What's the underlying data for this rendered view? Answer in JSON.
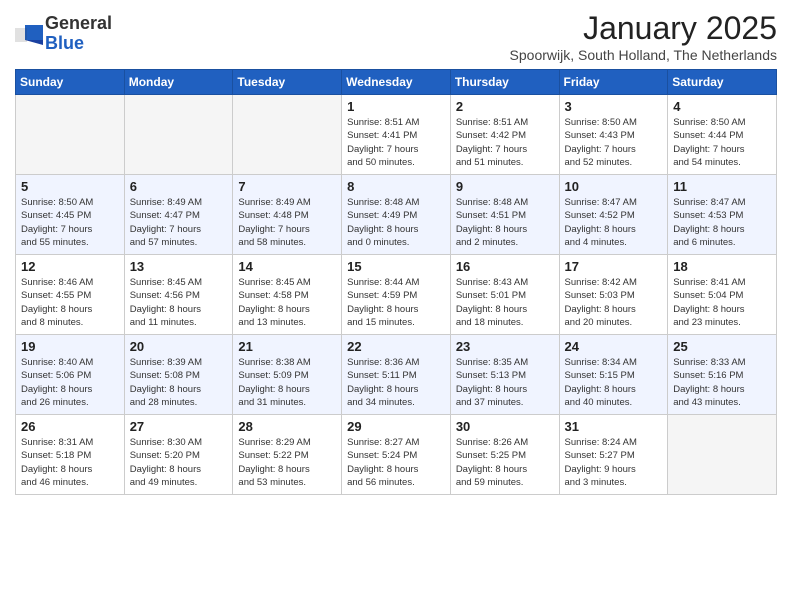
{
  "header": {
    "logo_general": "General",
    "logo_blue": "Blue",
    "month": "January 2025",
    "location": "Spoorwijk, South Holland, The Netherlands"
  },
  "days_of_week": [
    "Sunday",
    "Monday",
    "Tuesday",
    "Wednesday",
    "Thursday",
    "Friday",
    "Saturday"
  ],
  "weeks": [
    {
      "alt": false,
      "days": [
        {
          "num": "",
          "info": ""
        },
        {
          "num": "",
          "info": ""
        },
        {
          "num": "",
          "info": ""
        },
        {
          "num": "1",
          "info": "Sunrise: 8:51 AM\nSunset: 4:41 PM\nDaylight: 7 hours\nand 50 minutes."
        },
        {
          "num": "2",
          "info": "Sunrise: 8:51 AM\nSunset: 4:42 PM\nDaylight: 7 hours\nand 51 minutes."
        },
        {
          "num": "3",
          "info": "Sunrise: 8:50 AM\nSunset: 4:43 PM\nDaylight: 7 hours\nand 52 minutes."
        },
        {
          "num": "4",
          "info": "Sunrise: 8:50 AM\nSunset: 4:44 PM\nDaylight: 7 hours\nand 54 minutes."
        }
      ]
    },
    {
      "alt": true,
      "days": [
        {
          "num": "5",
          "info": "Sunrise: 8:50 AM\nSunset: 4:45 PM\nDaylight: 7 hours\nand 55 minutes."
        },
        {
          "num": "6",
          "info": "Sunrise: 8:49 AM\nSunset: 4:47 PM\nDaylight: 7 hours\nand 57 minutes."
        },
        {
          "num": "7",
          "info": "Sunrise: 8:49 AM\nSunset: 4:48 PM\nDaylight: 7 hours\nand 58 minutes."
        },
        {
          "num": "8",
          "info": "Sunrise: 8:48 AM\nSunset: 4:49 PM\nDaylight: 8 hours\nand 0 minutes."
        },
        {
          "num": "9",
          "info": "Sunrise: 8:48 AM\nSunset: 4:51 PM\nDaylight: 8 hours\nand 2 minutes."
        },
        {
          "num": "10",
          "info": "Sunrise: 8:47 AM\nSunset: 4:52 PM\nDaylight: 8 hours\nand 4 minutes."
        },
        {
          "num": "11",
          "info": "Sunrise: 8:47 AM\nSunset: 4:53 PM\nDaylight: 8 hours\nand 6 minutes."
        }
      ]
    },
    {
      "alt": false,
      "days": [
        {
          "num": "12",
          "info": "Sunrise: 8:46 AM\nSunset: 4:55 PM\nDaylight: 8 hours\nand 8 minutes."
        },
        {
          "num": "13",
          "info": "Sunrise: 8:45 AM\nSunset: 4:56 PM\nDaylight: 8 hours\nand 11 minutes."
        },
        {
          "num": "14",
          "info": "Sunrise: 8:45 AM\nSunset: 4:58 PM\nDaylight: 8 hours\nand 13 minutes."
        },
        {
          "num": "15",
          "info": "Sunrise: 8:44 AM\nSunset: 4:59 PM\nDaylight: 8 hours\nand 15 minutes."
        },
        {
          "num": "16",
          "info": "Sunrise: 8:43 AM\nSunset: 5:01 PM\nDaylight: 8 hours\nand 18 minutes."
        },
        {
          "num": "17",
          "info": "Sunrise: 8:42 AM\nSunset: 5:03 PM\nDaylight: 8 hours\nand 20 minutes."
        },
        {
          "num": "18",
          "info": "Sunrise: 8:41 AM\nSunset: 5:04 PM\nDaylight: 8 hours\nand 23 minutes."
        }
      ]
    },
    {
      "alt": true,
      "days": [
        {
          "num": "19",
          "info": "Sunrise: 8:40 AM\nSunset: 5:06 PM\nDaylight: 8 hours\nand 26 minutes."
        },
        {
          "num": "20",
          "info": "Sunrise: 8:39 AM\nSunset: 5:08 PM\nDaylight: 8 hours\nand 28 minutes."
        },
        {
          "num": "21",
          "info": "Sunrise: 8:38 AM\nSunset: 5:09 PM\nDaylight: 8 hours\nand 31 minutes."
        },
        {
          "num": "22",
          "info": "Sunrise: 8:36 AM\nSunset: 5:11 PM\nDaylight: 8 hours\nand 34 minutes."
        },
        {
          "num": "23",
          "info": "Sunrise: 8:35 AM\nSunset: 5:13 PM\nDaylight: 8 hours\nand 37 minutes."
        },
        {
          "num": "24",
          "info": "Sunrise: 8:34 AM\nSunset: 5:15 PM\nDaylight: 8 hours\nand 40 minutes."
        },
        {
          "num": "25",
          "info": "Sunrise: 8:33 AM\nSunset: 5:16 PM\nDaylight: 8 hours\nand 43 minutes."
        }
      ]
    },
    {
      "alt": false,
      "days": [
        {
          "num": "26",
          "info": "Sunrise: 8:31 AM\nSunset: 5:18 PM\nDaylight: 8 hours\nand 46 minutes."
        },
        {
          "num": "27",
          "info": "Sunrise: 8:30 AM\nSunset: 5:20 PM\nDaylight: 8 hours\nand 49 minutes."
        },
        {
          "num": "28",
          "info": "Sunrise: 8:29 AM\nSunset: 5:22 PM\nDaylight: 8 hours\nand 53 minutes."
        },
        {
          "num": "29",
          "info": "Sunrise: 8:27 AM\nSunset: 5:24 PM\nDaylight: 8 hours\nand 56 minutes."
        },
        {
          "num": "30",
          "info": "Sunrise: 8:26 AM\nSunset: 5:25 PM\nDaylight: 8 hours\nand 59 minutes."
        },
        {
          "num": "31",
          "info": "Sunrise: 8:24 AM\nSunset: 5:27 PM\nDaylight: 9 hours\nand 3 minutes."
        },
        {
          "num": "",
          "info": ""
        }
      ]
    }
  ]
}
